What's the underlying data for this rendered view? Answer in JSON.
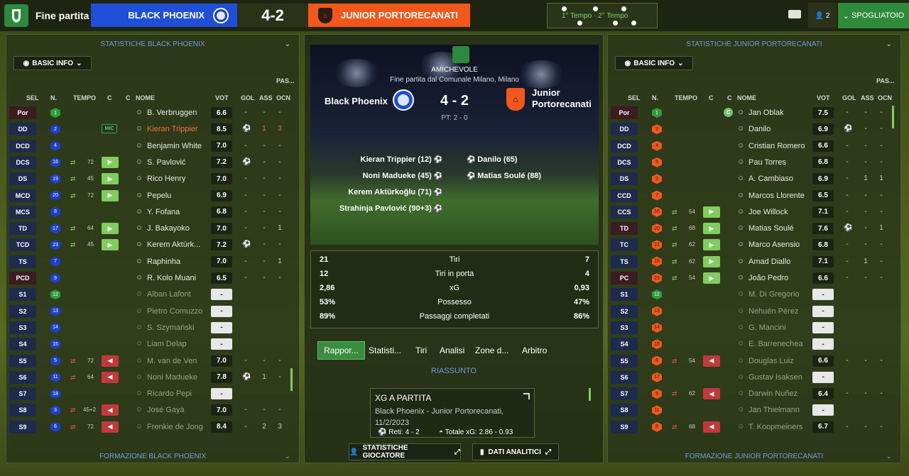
{
  "topbar": {
    "title": "Fine partita",
    "home_team": "BLACK PHOENIX",
    "score": "4-2",
    "away_team": "JUNIOR PORTORECANATI",
    "timeline_label": "1° Tempo · 2° Tempo",
    "user_count": "2",
    "dressing_room": "SPOGLIATOIO"
  },
  "left": {
    "header": "STATISTICHE BLACK PHOENIX",
    "view_label": "BASIC INFO",
    "footer": "FORMAZIONE BLACK PHOENIX",
    "columns": {
      "sel": "SEL",
      "n": "N.",
      "tempo": "TEMPO",
      "c1": "C",
      "c2": "C",
      "nome": "NOME",
      "vot": "VOT",
      "gol": "GOL",
      "ass": "ASS",
      "pas": "PAS...",
      "ocn": "OCN"
    },
    "players": [
      {
        "pos": "Por",
        "num": "1",
        "kit": "green",
        "name": "B. Verbruggen",
        "vote": "6.6",
        "gol": "-",
        "ass": "-",
        "ocn": "-",
        "gk": true
      },
      {
        "pos": "DD",
        "num": "2",
        "kit": "blue",
        "name": "Kieran Trippier",
        "vote": "8.5",
        "gol": "ball",
        "ass": "1",
        "ocn": "3",
        "captain": "MIC",
        "hl": true
      },
      {
        "pos": "DCD",
        "num": "4",
        "kit": "blue",
        "name": "Benjamin White",
        "vote": "7.0",
        "gol": "-",
        "ass": "-",
        "ocn": "-"
      },
      {
        "pos": "DCS",
        "num": "16",
        "kit": "blue",
        "name": "S. Pavlović",
        "vote": "7.2",
        "gol": "ball",
        "ass": "-",
        "ocn": "-",
        "sub": "in",
        "min": "72"
      },
      {
        "pos": "DS",
        "num": "19",
        "kit": "blue",
        "name": "Rico Henry",
        "vote": "7.0",
        "gol": "-",
        "ass": "-",
        "ocn": "-",
        "sub": "in",
        "min": "45"
      },
      {
        "pos": "MCD",
        "num": "20",
        "kit": "blue",
        "name": "Pepelu",
        "vote": "6.9",
        "gol": "-",
        "ass": "-",
        "ocn": "-",
        "sub": "in",
        "min": "72"
      },
      {
        "pos": "MCS",
        "num": "8",
        "kit": "blue",
        "name": "Y. Fofana",
        "vote": "6.8",
        "gol": "-",
        "ass": "-",
        "ocn": "-"
      },
      {
        "pos": "TD",
        "num": "17",
        "kit": "blue",
        "name": "J. Bakayoko",
        "vote": "7.0",
        "gol": "-",
        "ass": "-",
        "ocn": "1",
        "sub": "in",
        "min": "64"
      },
      {
        "pos": "TCD",
        "num": "23",
        "kit": "blue",
        "name": "Kerem Aktürk...",
        "vote": "7.2",
        "gol": "ball",
        "ass": "-",
        "ocn": "-",
        "sub": "in",
        "min": "45"
      },
      {
        "pos": "TS",
        "num": "7",
        "kit": "blue",
        "name": "Raphinha",
        "vote": "7.0",
        "gol": "-",
        "ass": "-",
        "ocn": "1"
      },
      {
        "pos": "PCD",
        "num": "9",
        "kit": "blue",
        "name": "R. Kolo Muani",
        "vote": "6.5",
        "gol": "-",
        "ass": "-",
        "ocn": "-",
        "gk": true
      },
      {
        "pos": "S1",
        "num": "12",
        "kit": "green",
        "name": "Alban Lafont",
        "vote": "-",
        "gol": "",
        "ass": "",
        "ocn": "",
        "dim": true
      },
      {
        "pos": "S2",
        "num": "13",
        "kit": "blue",
        "name": "Pietro Comuzzo",
        "vote": "-",
        "gol": "",
        "ass": "",
        "ocn": "",
        "dim": true
      },
      {
        "pos": "S3",
        "num": "14",
        "kit": "blue",
        "name": "S. Szymański",
        "vote": "-",
        "gol": "",
        "ass": "",
        "ocn": "",
        "dim": true
      },
      {
        "pos": "S4",
        "num": "15",
        "kit": "blue",
        "name": "Liam Delap",
        "vote": "-",
        "gol": "",
        "ass": "",
        "ocn": "",
        "dim": true
      },
      {
        "pos": "S5",
        "num": "5",
        "kit": "blue",
        "name": "M. van de Ven",
        "vote": "7.0",
        "gol": "-",
        "ass": "-",
        "ocn": "-",
        "sub": "out",
        "min": "72",
        "dim": true
      },
      {
        "pos": "S6",
        "num": "11",
        "kit": "blue",
        "name": "Noni Madueke",
        "vote": "7.8",
        "gol": "ball",
        "ass": "1",
        "ocn": "-",
        "sub": "out",
        "min": "64",
        "dim": true
      },
      {
        "pos": "S7",
        "num": "18",
        "kit": "blue",
        "name": "Ricardo Pepi",
        "vote": "-",
        "gol": "",
        "ass": "",
        "ocn": "",
        "dim": true
      },
      {
        "pos": "S8",
        "num": "3",
        "kit": "blue",
        "name": "José Gayà",
        "vote": "7.0",
        "gol": "-",
        "ass": "-",
        "ocn": "-",
        "sub": "out",
        "min": "45+2",
        "dim": true
      },
      {
        "pos": "S9",
        "num": "6",
        "kit": "blue",
        "name": "Frenkie de Jong",
        "vote": "8.4",
        "gol": "-",
        "ass": "2",
        "ocn": "3",
        "sub": "out",
        "min": "72",
        "dim": true
      }
    ]
  },
  "right": {
    "header": "STATISTICHE JUNIOR PORTORECANATI",
    "view_label": "BASIC INFO",
    "footer": "FORMAZIONE JUNIOR PORTORECANATI",
    "columns": {
      "sel": "SEL",
      "n": "N.",
      "tempo": "TEMPO",
      "c1": "C",
      "c2": "C",
      "nome": "NOME",
      "vot": "VOT",
      "gol": "GOL",
      "ass": "ASS",
      "pas": "PAS...",
      "ocn": "OCN"
    },
    "players": [
      {
        "pos": "Por",
        "num": "1",
        "kit": "green",
        "name": "Jan Oblak",
        "vote": "7.5",
        "gol": "-",
        "ass": "-",
        "ocn": "-",
        "cbadge": "C",
        "gk": true
      },
      {
        "pos": "DD",
        "num": "2",
        "kit": "orange",
        "name": "Danilo",
        "vote": "6.9",
        "gol": "ball",
        "ass": "-",
        "ocn": "-"
      },
      {
        "pos": "DCD",
        "num": "4",
        "kit": "orange",
        "name": "Cristian Romero",
        "vote": "6.6",
        "gol": "-",
        "ass": "-",
        "ocn": "-"
      },
      {
        "pos": "DCS",
        "num": "5",
        "kit": "orange",
        "name": "Pau Torres",
        "vote": "6.8",
        "gol": "-",
        "ass": "-",
        "ocn": "-"
      },
      {
        "pos": "DS",
        "num": "3",
        "kit": "orange",
        "name": "A. Cambiaso",
        "vote": "6.9",
        "gol": "-",
        "ass": "1",
        "ocn": "1"
      },
      {
        "pos": "CCD",
        "num": "7",
        "kit": "orange",
        "name": "Marcos Llorente",
        "vote": "6.5",
        "gol": "-",
        "ass": "-",
        "ocn": "-"
      },
      {
        "pos": "CCS",
        "num": "16",
        "kit": "orange",
        "name": "Joe Willock",
        "vote": "7.1",
        "gol": "-",
        "ass": "-",
        "ocn": "-",
        "sub": "in",
        "min": "54"
      },
      {
        "pos": "TD",
        "num": "20",
        "kit": "orange",
        "name": "Matias Soulé",
        "vote": "7.6",
        "gol": "ball",
        "ass": "-",
        "ocn": "1",
        "sub": "in",
        "min": "68",
        "gk": true
      },
      {
        "pos": "TC",
        "num": "21",
        "kit": "orange",
        "name": "Marco Asensio",
        "vote": "6.8",
        "gol": "-",
        "ass": "-",
        "ocn": "-",
        "sub": "in",
        "min": "62"
      },
      {
        "pos": "TS",
        "num": "19",
        "kit": "orange",
        "name": "Amad Diallo",
        "vote": "7.1",
        "gol": "-",
        "ass": "1",
        "ocn": "-",
        "sub": "in",
        "min": "62"
      },
      {
        "pos": "PC",
        "num": "23",
        "kit": "orange",
        "name": "João Pedro",
        "vote": "6.6",
        "gol": "-",
        "ass": "-",
        "ocn": "-",
        "sub": "in",
        "min": "54",
        "gk": true
      },
      {
        "pos": "S1",
        "num": "12",
        "kit": "green",
        "name": "M. Di Gregorio",
        "vote": "-",
        "gol": "",
        "ass": "",
        "ocn": "",
        "dim": true
      },
      {
        "pos": "S2",
        "num": "13",
        "kit": "orange",
        "name": "Nehuén Pérez",
        "vote": "-",
        "gol": "",
        "ass": "",
        "ocn": "",
        "dim": true
      },
      {
        "pos": "S3",
        "num": "14",
        "kit": "orange",
        "name": "G. Mancini",
        "vote": "-",
        "gol": "",
        "ass": "",
        "ocn": "",
        "dim": true
      },
      {
        "pos": "S4",
        "num": "15",
        "kit": "orange",
        "name": "E. Barrenechea",
        "vote": "-",
        "gol": "",
        "ass": "",
        "ocn": "",
        "dim": true
      },
      {
        "pos": "S5",
        "num": "6",
        "kit": "orange",
        "name": "Douglas Luiz",
        "vote": "6.6",
        "gol": "-",
        "ass": "-",
        "ocn": "-",
        "sub": "out",
        "min": "54",
        "dim": true
      },
      {
        "pos": "S6",
        "num": "17",
        "kit": "orange",
        "name": "Gustav Isaksen",
        "vote": "-",
        "gol": "",
        "ass": "",
        "ocn": "",
        "dim": true
      },
      {
        "pos": "S7",
        "num": "9",
        "kit": "orange",
        "name": "Darwin Nuñez",
        "vote": "6.4",
        "gol": "-",
        "ass": "-",
        "ocn": "-",
        "sub": "out",
        "min": "62",
        "dim": true
      },
      {
        "pos": "S8",
        "num": "11",
        "kit": "orange",
        "name": "Jan Thielmann",
        "vote": "-",
        "gol": "",
        "ass": "",
        "ocn": "",
        "dim": true
      },
      {
        "pos": "S9",
        "num": "8",
        "kit": "orange",
        "name": "T. Koopmeiners",
        "vote": "6.7",
        "gol": "-",
        "ass": "-",
        "ocn": "-",
        "sub": "out",
        "min": "68",
        "dim": true
      }
    ]
  },
  "center": {
    "competition": "AMICHEVOLE",
    "subtitle": "Fine partita dal Comunale Milano, Milano",
    "home": "Black Phoenix",
    "away_line1": "Junior",
    "away_line2": "Portorecanati",
    "score": "4 - 2",
    "pt": "PT: 2 - 0",
    "home_scorers": [
      "Kieran Trippier (12)",
      "Noni Madueke (45)",
      "Kerem Aktürkoğlu (71)",
      "Strahinja Pavlović (90+3)"
    ],
    "away_scorers": [
      "Danilo (65)",
      "Matias Soulé (88)"
    ],
    "stats": [
      {
        "a": "21",
        "name": "Tiri",
        "b": "7"
      },
      {
        "a": "12",
        "name": "Tiri in porta",
        "b": "4"
      },
      {
        "a": "2,86",
        "name": "xG",
        "b": "0,93"
      },
      {
        "a": "53%",
        "name": "Possesso",
        "b": "47%"
      },
      {
        "a": "89%",
        "name": "Passaggi completati",
        "b": "86%"
      }
    ],
    "tabs": [
      "Rappor...",
      "Statisti...",
      "Tiri",
      "Analisi",
      "Zone d...",
      "Arbitro"
    ],
    "riassunto": "RIASSUNTO",
    "xg_card": {
      "title": "XG A PARTITA",
      "line1": "Black Phoenix - Junior Portorecanati,",
      "line2": "11/2/2023",
      "reti": "Reti: 4 - 2",
      "totale": "Totale xG: 2.86 - 0.93"
    },
    "btn_players": "STATISTICHE GIOCATORE",
    "btn_data": "DATI ANALITICI"
  },
  "colors": {
    "home": "#1f4fd8",
    "away": "#f2571b",
    "accent": "#2f8a3a"
  }
}
